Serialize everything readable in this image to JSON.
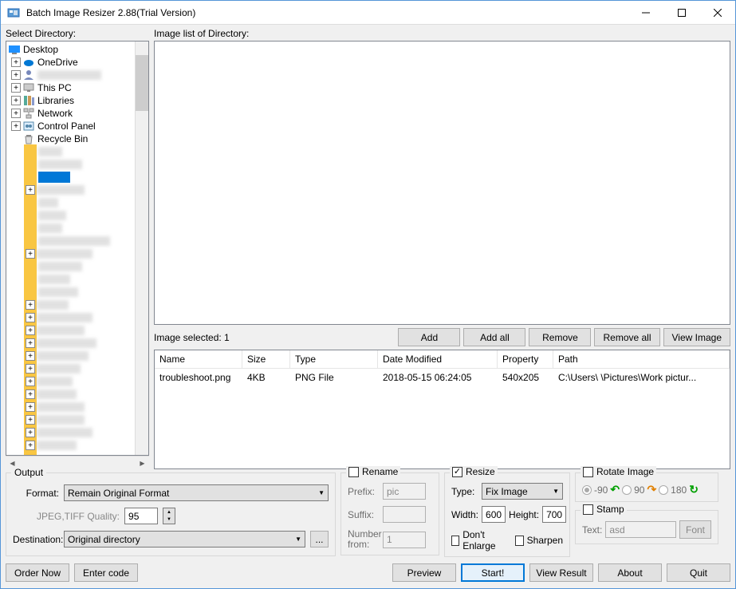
{
  "window": {
    "title": "Batch Image Resizer 2.88(Trial Version)"
  },
  "labels": {
    "select_directory": "Select Directory:",
    "image_list": "Image list of Directory:",
    "image_selected": "Image selected: 1"
  },
  "tree": {
    "root": "Desktop",
    "items": [
      "OneDrive",
      "",
      "This PC",
      "Libraries",
      "Network",
      "Control Panel",
      "Recycle Bin"
    ]
  },
  "buttons": {
    "add": "Add",
    "add_all": "Add all",
    "remove": "Remove",
    "remove_all": "Remove all",
    "view_image": "View Image",
    "order_now": "Order Now",
    "enter_code": "Enter code",
    "preview": "Preview",
    "start": "Start!",
    "view_result": "View Result",
    "about": "About",
    "quit": "Quit",
    "font": "Font"
  },
  "table": {
    "headers": {
      "name": "Name",
      "size": "Size",
      "type": "Type",
      "date": "Date Modified",
      "property": "Property",
      "path": "Path"
    },
    "row": {
      "name": "troubleshoot.png",
      "size": "4KB",
      "type": "PNG File",
      "date": "2018-05-15 06:24:05",
      "property": "540x205",
      "path": "C:\\Users\\        \\Pictures\\Work pictur..."
    }
  },
  "output": {
    "title": "Output",
    "format_label": "Format:",
    "format_value": "Remain Original Format",
    "quality_label": "JPEG,TIFF Quality:",
    "quality_value": "95",
    "destination_label": "Destination:",
    "destination_value": "Original directory",
    "browse": "..."
  },
  "rename": {
    "title": "Rename",
    "prefix_label": "Prefix:",
    "prefix_value": "pic",
    "suffix_label": "Suffix:",
    "number_label": "Number from:",
    "number_value": "1"
  },
  "resize": {
    "title": "Resize",
    "type_label": "Type:",
    "type_value": "Fix Image",
    "width_label": "Width:",
    "width_value": "600",
    "height_label": "Height:",
    "height_value": "700",
    "dont_enlarge": "Don't Enlarge",
    "sharpen": "Sharpen"
  },
  "rotate": {
    "title": "Rotate Image",
    "neg90": "-90",
    "pos90": "90",
    "r180": "180"
  },
  "stamp": {
    "title": "Stamp",
    "text_label": "Text:",
    "text_value": "asd"
  }
}
